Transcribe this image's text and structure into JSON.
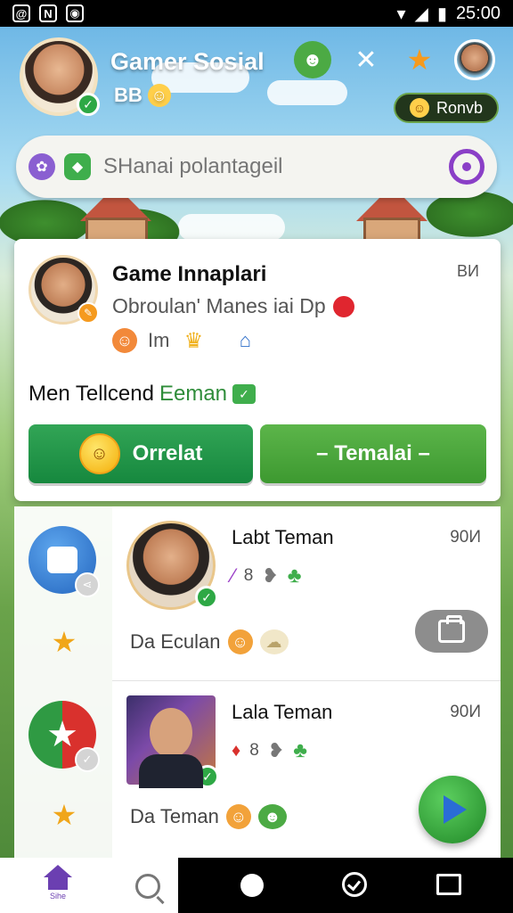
{
  "status_bar": {
    "left_icons": [
      "@",
      "N",
      "◉"
    ],
    "time": "25:00"
  },
  "header": {
    "title": "Gamer Sosial",
    "subtitle": "BB",
    "rank_label": "Ronvb"
  },
  "search": {
    "placeholder": "SHanai polantageil"
  },
  "card": {
    "title": "Game Innaplari",
    "badge": "BИ",
    "subtitle": "Obroulan' Manes iai Dp",
    "meta": "Im",
    "line_prefix": "Men Tellcend",
    "line_highlight": "Eeman",
    "primary_button": "Orrelat",
    "secondary_button": "– Temalai –"
  },
  "list": [
    {
      "name": "Labt Teman",
      "time": "90И",
      "meta_count": "8",
      "message": "Da Eculan"
    },
    {
      "name": "Lala Teman",
      "time": "90И",
      "meta_count": "8",
      "message": "Da Teman"
    }
  ],
  "nav": {
    "home_label": "Sihe"
  },
  "colors": {
    "accent_green": "#2ea845",
    "brand_purple": "#8a3fc7",
    "primary_button": "#16883e"
  }
}
